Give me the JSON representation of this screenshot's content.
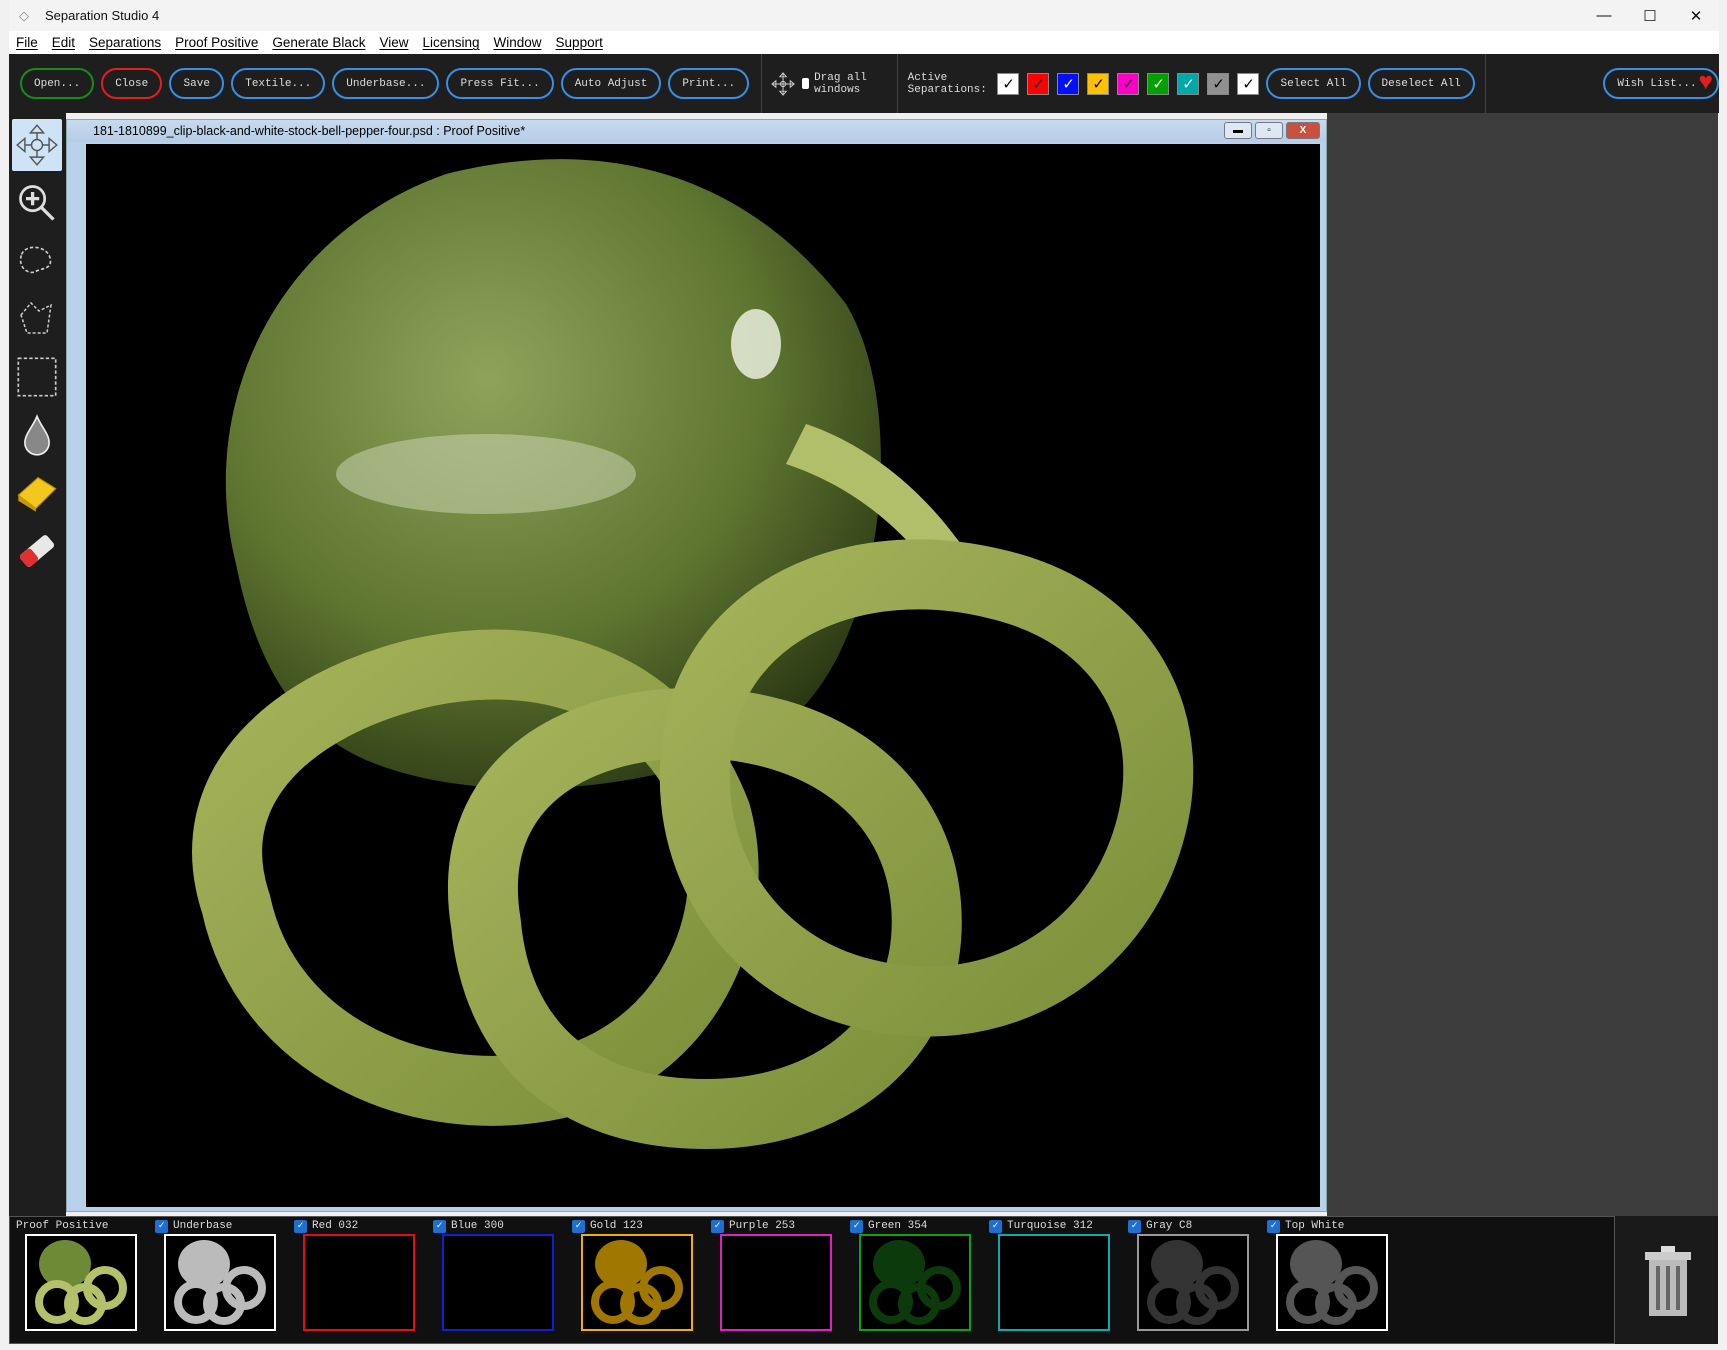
{
  "app": {
    "title": "Separation Studio 4"
  },
  "window_controls": {
    "minimize": "—",
    "maximize": "☐",
    "close": "✕"
  },
  "menu": [
    "File",
    "Edit",
    "Separations",
    "Proof Positive",
    "Generate Black",
    "View",
    "Licensing",
    "Window",
    "Support"
  ],
  "toolbar": {
    "buttons": [
      {
        "label": "Open...",
        "color": "#1a8a1a"
      },
      {
        "label": "Close",
        "color": "#e02020"
      },
      {
        "label": "Save",
        "color": "#3a8ee6"
      },
      {
        "label": "Textile...",
        "color": "#3a8ee6"
      },
      {
        "label": "Underbase...",
        "color": "#3a8ee6"
      },
      {
        "label": "Press Fit...",
        "color": "#3a8ee6"
      },
      {
        "label": "Auto Adjust",
        "color": "#3a8ee6"
      },
      {
        "label": "Print...",
        "color": "#3a8ee6"
      }
    ],
    "drag_all_windows": {
      "label": "Drag all windows",
      "checked": false
    },
    "active_separations_label": "Active Separations:",
    "separation_checks": [
      {
        "color": "#ffffff",
        "checked": true
      },
      {
        "color": "#ff0000",
        "checked": true
      },
      {
        "color": "#0010ff",
        "checked": true
      },
      {
        "color": "#ffc000",
        "checked": true
      },
      {
        "color": "#ff00c8",
        "checked": true
      },
      {
        "color": "#00a000",
        "checked": true
      },
      {
        "color": "#00a8a8",
        "checked": true
      },
      {
        "color": "#909090",
        "checked": true
      },
      {
        "color": "#ffffff",
        "checked": true
      }
    ],
    "select_all": "Select All",
    "deselect_all": "Deselect All",
    "wish_list": "Wish List..."
  },
  "tools": [
    "move-tool",
    "zoom-tool",
    "lasso-tool",
    "polygon-lasso-tool",
    "rect-select-tool",
    "dropper-tool",
    "sponge-tool",
    "eraser-tool"
  ],
  "document": {
    "title": "181-1810899_clip-black-and-white-stock-bell-pepper-four.psd : Proof Positive*"
  },
  "separations": [
    {
      "name": "Proof Positive",
      "checkbox": false,
      "border": "#ffffff",
      "tint": "full"
    },
    {
      "name": "Underbase",
      "checkbox": true,
      "border": "#ffffff",
      "tint": "#bbbbbb"
    },
    {
      "name": "Red 032",
      "checkbox": true,
      "border": "#e01010",
      "tint": "none"
    },
    {
      "name": "Blue 300",
      "checkbox": true,
      "border": "#1020d0",
      "tint": "none"
    },
    {
      "name": "Gold 123",
      "checkbox": true,
      "border": "#f0b000",
      "tint": "#a07800"
    },
    {
      "name": "Purple 253",
      "checkbox": true,
      "border": "#e020c0",
      "tint": "none"
    },
    {
      "name": "Green 354",
      "checkbox": true,
      "border": "#10a010",
      "tint": "#0d3a0d"
    },
    {
      "name": "Turquoise 312",
      "checkbox": true,
      "border": "#10a8b0",
      "tint": "none"
    },
    {
      "name": "Gray C8",
      "checkbox": true,
      "border": "#999999",
      "tint": "#333333"
    },
    {
      "name": "Top White",
      "checkbox": true,
      "border": "#ffffff",
      "tint": "#555555"
    }
  ]
}
